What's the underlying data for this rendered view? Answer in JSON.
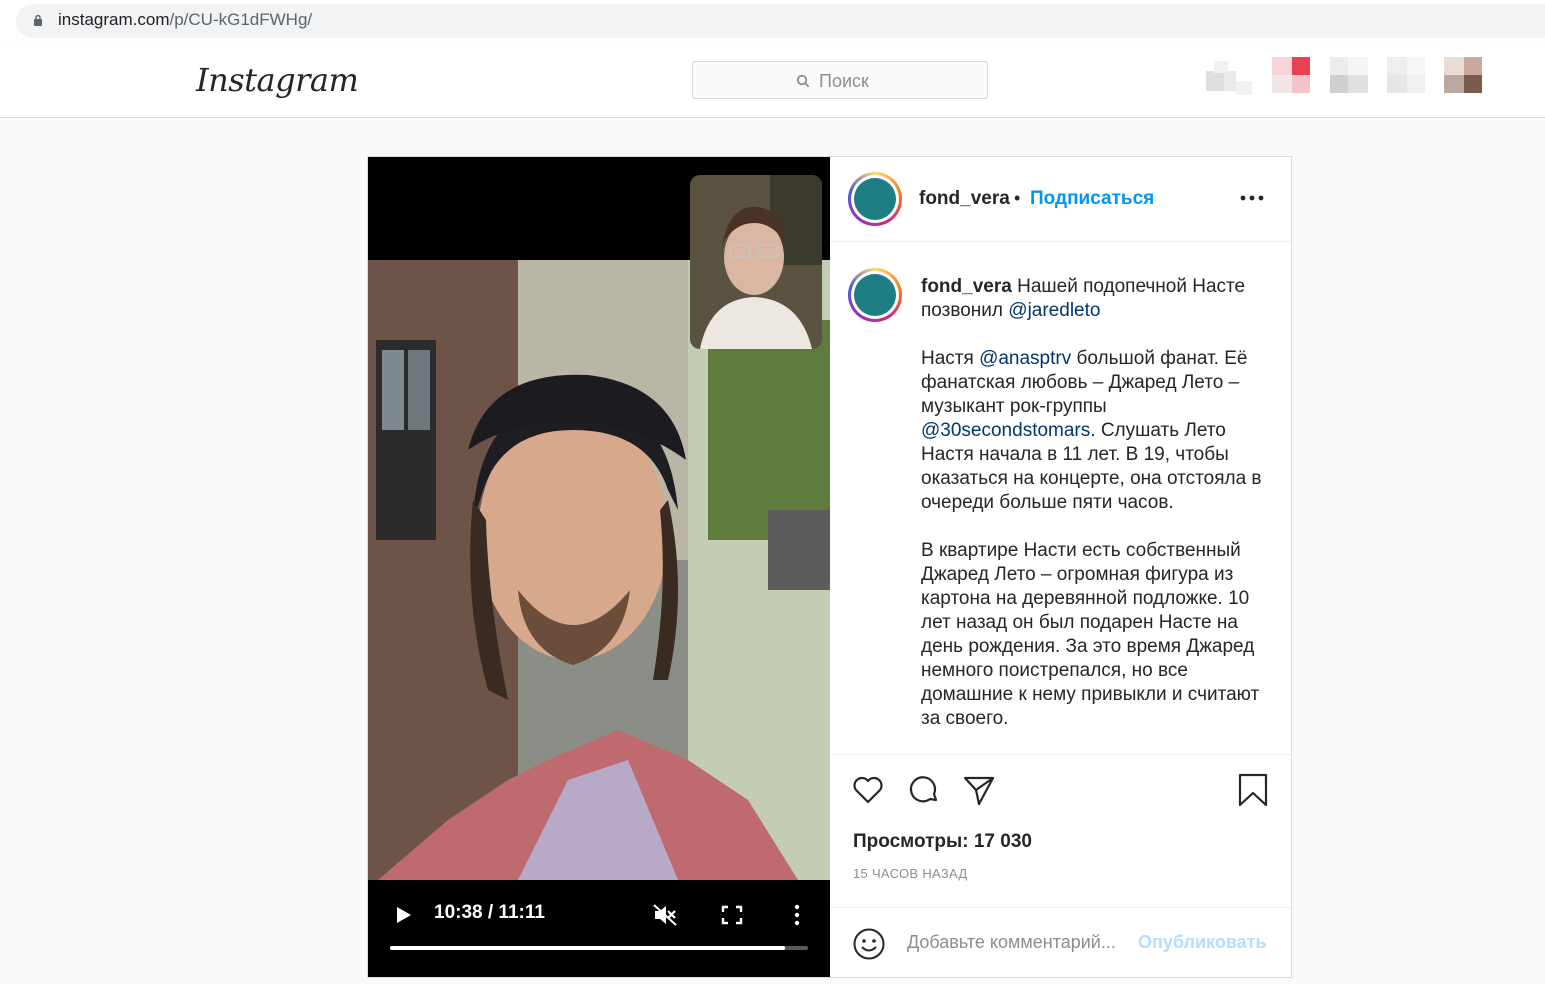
{
  "browser": {
    "url_host": "instagram.com",
    "url_path": "/p/CU-kG1dFWHg/"
  },
  "header": {
    "logo": "Instagram",
    "search_placeholder": "Поиск",
    "icons": [
      "home-icon",
      "direct-icon",
      "explore-icon",
      "activity-icon",
      "profile-avatar"
    ]
  },
  "post": {
    "video": {
      "time": "10:38 / 11:11",
      "progress": 0.945
    },
    "author": "fond_vera",
    "dot": "•",
    "follow_label": "Подписаться",
    "caption": {
      "username": "fond_vera",
      "text_1": " Нашей подопечной Насте позвонил ",
      "mention_1": "@jaredleto",
      "text_2": "\n\nНастя ",
      "mention_2": "@anasptrv",
      "text_3": " большой фанат. Её фанатская любовь – Джаред Лето – музыкант рок-группы ",
      "mention_3": "@30secondstomars",
      "text_4": ". Слушать Лето Настя начала в 11 лет. В 19, чтобы оказаться на концерте, она отстояла в очереди больше пяти часов.\n\nВ квартире Насти есть собственный Джаред Лето – огромная фигура из картона на деревянной подложке. 10 лет назад он был подарен Насте на день рождения. За это время Джаред немного поистрепался, но все домашние к нему привыкли и считают за своего."
    },
    "views": "Просмотры: 17 030",
    "time_ago": "15 ЧАСОВ НАЗАД",
    "comment_placeholder": "Добавьте комментарий...",
    "publish_label": "Опубликовать"
  },
  "colors": {
    "accent": "#0095f6",
    "mention": "#00376b",
    "publish_disabled": "#b2dffc",
    "avatar_teal": "#1d7f84"
  }
}
